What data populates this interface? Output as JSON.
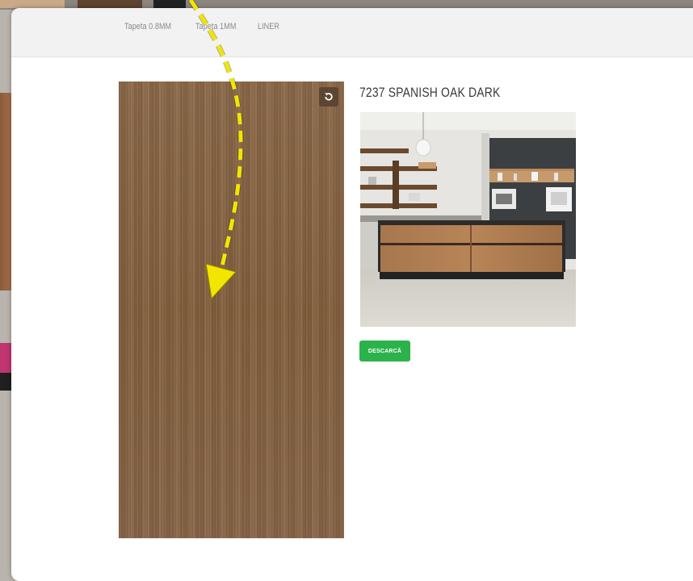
{
  "tabs": [
    {
      "label": "Tapeta 0.8MM"
    },
    {
      "label": "Tapeta 1MM"
    },
    {
      "label": "LINER"
    }
  ],
  "product": {
    "title": "7237 SPANISH OAK DARK",
    "download_label": "DESCARCĂ"
  },
  "icons": {
    "rotate": "rotate-icon"
  },
  "colors": {
    "accent_button": "#2bb24a",
    "wood": "#836343",
    "annotation_arrow": "#f2e600"
  }
}
